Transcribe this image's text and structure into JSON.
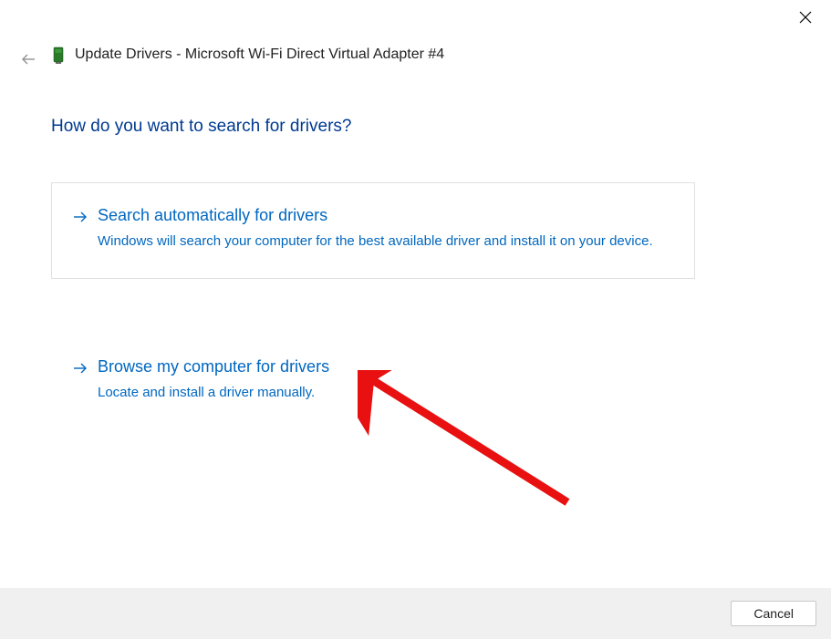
{
  "window": {
    "title": "Update Drivers - Microsoft Wi-Fi Direct Virtual Adapter #4"
  },
  "heading": "How do you want to search for drivers?",
  "options": [
    {
      "title": "Search automatically for drivers",
      "description": "Windows will search your computer for the best available driver and install it on your device."
    },
    {
      "title": "Browse my computer for drivers",
      "description": "Locate and install a driver manually."
    }
  ],
  "footer": {
    "cancel_label": "Cancel"
  }
}
